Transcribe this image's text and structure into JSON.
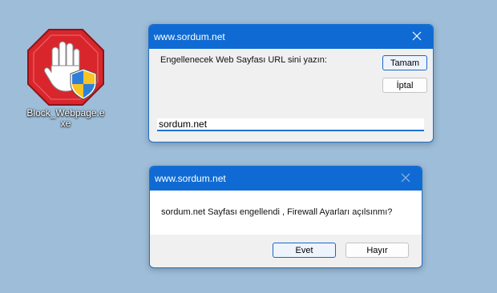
{
  "desktop_icon": {
    "label": "Block_Webpage.exe",
    "icon": "stop-hand-shield-icon",
    "colors": {
      "octagon": "#d8262c",
      "shield_blue": "#2f7fd8",
      "shield_yellow": "#f7c325"
    }
  },
  "input_dialog": {
    "title": "www.sordum.net",
    "prompt": "Engellenecek Web Sayfası URL sini yazın:",
    "ok_label": "Tamam",
    "cancel_label": "İptal",
    "input_value": "sordum.net"
  },
  "confirm_dialog": {
    "title": "www.sordum.net",
    "message": "sordum.net Sayfası engellendi , Firewall Ayarları açılsınmı?",
    "yes_label": "Evet",
    "no_label": "Hayır"
  },
  "colors": {
    "desktop_bg": "#9dbdd8",
    "titlebar": "#0f6bd3",
    "dialog_bg": "#f0f0f0"
  }
}
